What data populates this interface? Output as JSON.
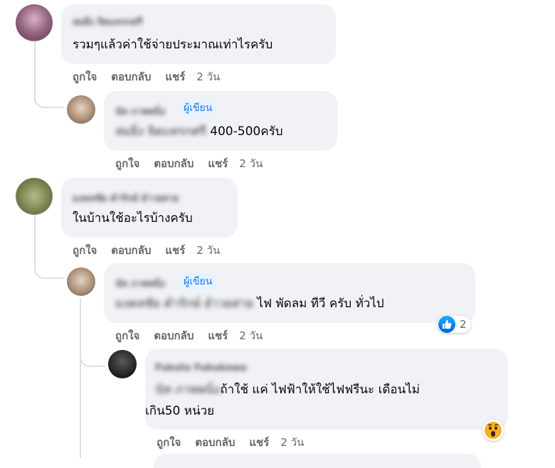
{
  "actions": {
    "like": "ถูกใจ",
    "reply": "ตอบกลับ",
    "share": "แชร์"
  },
  "author_badge": "ผู้เขียน",
  "comments": [
    {
      "name": "สมยิ่ง จิตแทรกศรี",
      "text": "รวมๆแล้วค่าใช้จ่ายประมาณเท่าไรครับ",
      "time": "2 วัน"
    },
    {
      "name": "นัท ภาพพนิ่ง",
      "mention": "สมยิ่ง จิตแทรกศรี",
      "text": " 400-500ครับ",
      "time": "2 วัน"
    },
    {
      "name": "มงคลชัย คำรักษ์ ยำวยสาย",
      "text": "ในบ้านใช้อะไรบ้างครับ",
      "time": "2 วัน"
    },
    {
      "name": "นัท ภาพพนิ่ง",
      "mention": "มงคลชัย คำรักษ์ ยำวยสาย",
      "text": " ไฟ พัดลม ทีวี ครับ ทั่วไป",
      "time": "2 วัน",
      "reaction_count": "2"
    },
    {
      "name": "Fukuto Fukukawa",
      "mention": "นัท ภาพพนิ่ง",
      "text_line1": "ถ้าใช้ แค่ ไฟฟ้าให้ใช้ไฟฟรีนะ เดือนไม่",
      "text_line2": "เกิน50 หน่วย",
      "time": "2 วัน"
    }
  ],
  "colors": {
    "bubble": "#f0f2f5",
    "action": "#65676b",
    "badge_bg": "#e7f3ff",
    "badge_text": "#1877f2"
  }
}
